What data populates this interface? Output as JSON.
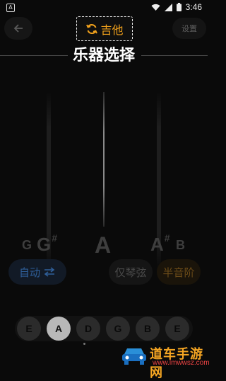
{
  "status_bar": {
    "app_badge": "A",
    "time": "3:46"
  },
  "toolbar": {
    "instrument_label": "吉他",
    "settings_label": "设置"
  },
  "page_title": "乐器选择",
  "tuner": {
    "notes": [
      {
        "letter": "G",
        "sharp": ""
      },
      {
        "letter": "G",
        "sharp": "#"
      },
      {
        "letter": "A",
        "sharp": ""
      },
      {
        "letter": "A",
        "sharp": "#"
      },
      {
        "letter": "B",
        "sharp": ""
      }
    ]
  },
  "modes": {
    "auto_label": "自动",
    "string_only_label": "仅琴弦",
    "semitone_label": "半音阶"
  },
  "strings": [
    {
      "label": "E",
      "active": false
    },
    {
      "label": "A",
      "active": true
    },
    {
      "label": "D",
      "active": false
    },
    {
      "label": "G",
      "active": false
    },
    {
      "label": "B",
      "active": false
    },
    {
      "label": "E",
      "active": false
    }
  ],
  "watermark": {
    "brand": "道车手游网",
    "url": "www.lmwwsz.com"
  },
  "colors": {
    "accent": "#f2a21c",
    "background": "#0a0a0a",
    "active_string": "#b8b8b8"
  }
}
